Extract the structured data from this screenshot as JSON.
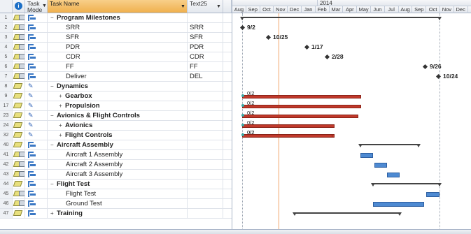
{
  "columns": {
    "mode": "Task\nMode",
    "mode_l1": "Task",
    "mode_l2": "Mode",
    "name": "Task Name",
    "text": "Text25"
  },
  "timeline": {
    "year": "2014",
    "months": [
      "Aug",
      "Sep",
      "Oct",
      "Nov",
      "Dec",
      "Jan",
      "Feb",
      "Mar",
      "Apr",
      "May",
      "Jun",
      "Jul",
      "Aug",
      "Sep",
      "Oct",
      "Nov",
      "Dec"
    ]
  },
  "rows": [
    {
      "id": "1",
      "name": "Program Milestones",
      "text": "",
      "level": 0,
      "toggle": "−",
      "bold": true,
      "mode": "auto",
      "people": true
    },
    {
      "id": "2",
      "name": "SRR",
      "text": "SRR",
      "level": 1,
      "toggle": "",
      "bold": false,
      "mode": "auto",
      "people": true
    },
    {
      "id": "3",
      "name": "SFR",
      "text": "SFR",
      "level": 1,
      "toggle": "",
      "bold": false,
      "mode": "auto",
      "people": true
    },
    {
      "id": "4",
      "name": "PDR",
      "text": "PDR",
      "level": 1,
      "toggle": "",
      "bold": false,
      "mode": "auto",
      "people": true
    },
    {
      "id": "5",
      "name": "CDR",
      "text": "CDR",
      "level": 1,
      "toggle": "",
      "bold": false,
      "mode": "auto",
      "people": true
    },
    {
      "id": "6",
      "name": "FF",
      "text": "FF",
      "level": 1,
      "toggle": "",
      "bold": false,
      "mode": "auto",
      "people": true
    },
    {
      "id": "7",
      "name": "Deliver",
      "text": "DEL",
      "level": 1,
      "toggle": "",
      "bold": false,
      "mode": "auto",
      "people": true
    },
    {
      "id": "8",
      "name": "Dynamics",
      "text": "",
      "level": 0,
      "toggle": "−",
      "bold": true,
      "mode": "pin",
      "people": false
    },
    {
      "id": "9",
      "name": "Gearbox",
      "text": "",
      "level": 1,
      "toggle": "+",
      "bold": true,
      "mode": "pin",
      "people": false
    },
    {
      "id": "17",
      "name": "Propulsion",
      "text": "",
      "level": 1,
      "toggle": "+",
      "bold": true,
      "mode": "pin",
      "people": false
    },
    {
      "id": "23",
      "name": "Avionics & Flight Controls",
      "text": "",
      "level": 0,
      "toggle": "−",
      "bold": true,
      "mode": "pin",
      "people": false
    },
    {
      "id": "24",
      "name": "Avionics",
      "text": "",
      "level": 1,
      "toggle": "+",
      "bold": true,
      "mode": "pin",
      "people": false
    },
    {
      "id": "32",
      "name": "Flight Controls",
      "text": "",
      "level": 1,
      "toggle": "+",
      "bold": true,
      "mode": "pin",
      "people": false
    },
    {
      "id": "40",
      "name": "Aircraft Assembly",
      "text": "",
      "level": 0,
      "toggle": "−",
      "bold": true,
      "mode": "auto",
      "people": false
    },
    {
      "id": "41",
      "name": "Aircraft 1 Assembly",
      "text": "",
      "level": 1,
      "toggle": "",
      "bold": false,
      "mode": "auto",
      "people": true
    },
    {
      "id": "42",
      "name": "Aircraft 2 Assembly",
      "text": "",
      "level": 1,
      "toggle": "",
      "bold": false,
      "mode": "auto",
      "people": true
    },
    {
      "id": "43",
      "name": "Aircraft 3 Assembly",
      "text": "",
      "level": 1,
      "toggle": "",
      "bold": false,
      "mode": "auto",
      "people": true
    },
    {
      "id": "44",
      "name": "Flight Test",
      "text": "",
      "level": 0,
      "toggle": "−",
      "bold": true,
      "mode": "auto",
      "people": false
    },
    {
      "id": "45",
      "name": "Flight Test",
      "text": "",
      "level": 1,
      "toggle": "",
      "bold": false,
      "mode": "auto",
      "people": true
    },
    {
      "id": "46",
      "name": "Ground Test",
      "text": "",
      "level": 1,
      "toggle": "",
      "bold": false,
      "mode": "auto",
      "people": true
    },
    {
      "id": "47",
      "name": "Training",
      "text": "",
      "level": 0,
      "toggle": "+",
      "bold": true,
      "mode": "auto",
      "people": false
    }
  ],
  "milestones": [
    {
      "row": 1,
      "label": "9/2"
    },
    {
      "row": 2,
      "label": "10/25"
    },
    {
      "row": 3,
      "label": "1/17"
    },
    {
      "row": 4,
      "label": "2/28"
    },
    {
      "row": 5,
      "label": "9/26"
    },
    {
      "row": 6,
      "label": "10/24"
    }
  ],
  "critical_labels": [
    "0/2",
    "0/2",
    "0/2",
    "0/2",
    "0/2",
    "0/2"
  ],
  "colors": {
    "critical": "#c0392b",
    "summary": "#444444",
    "task": "#4e8ad2",
    "status_line": "#f2a46a",
    "header_selected": "#f0b04d"
  }
}
